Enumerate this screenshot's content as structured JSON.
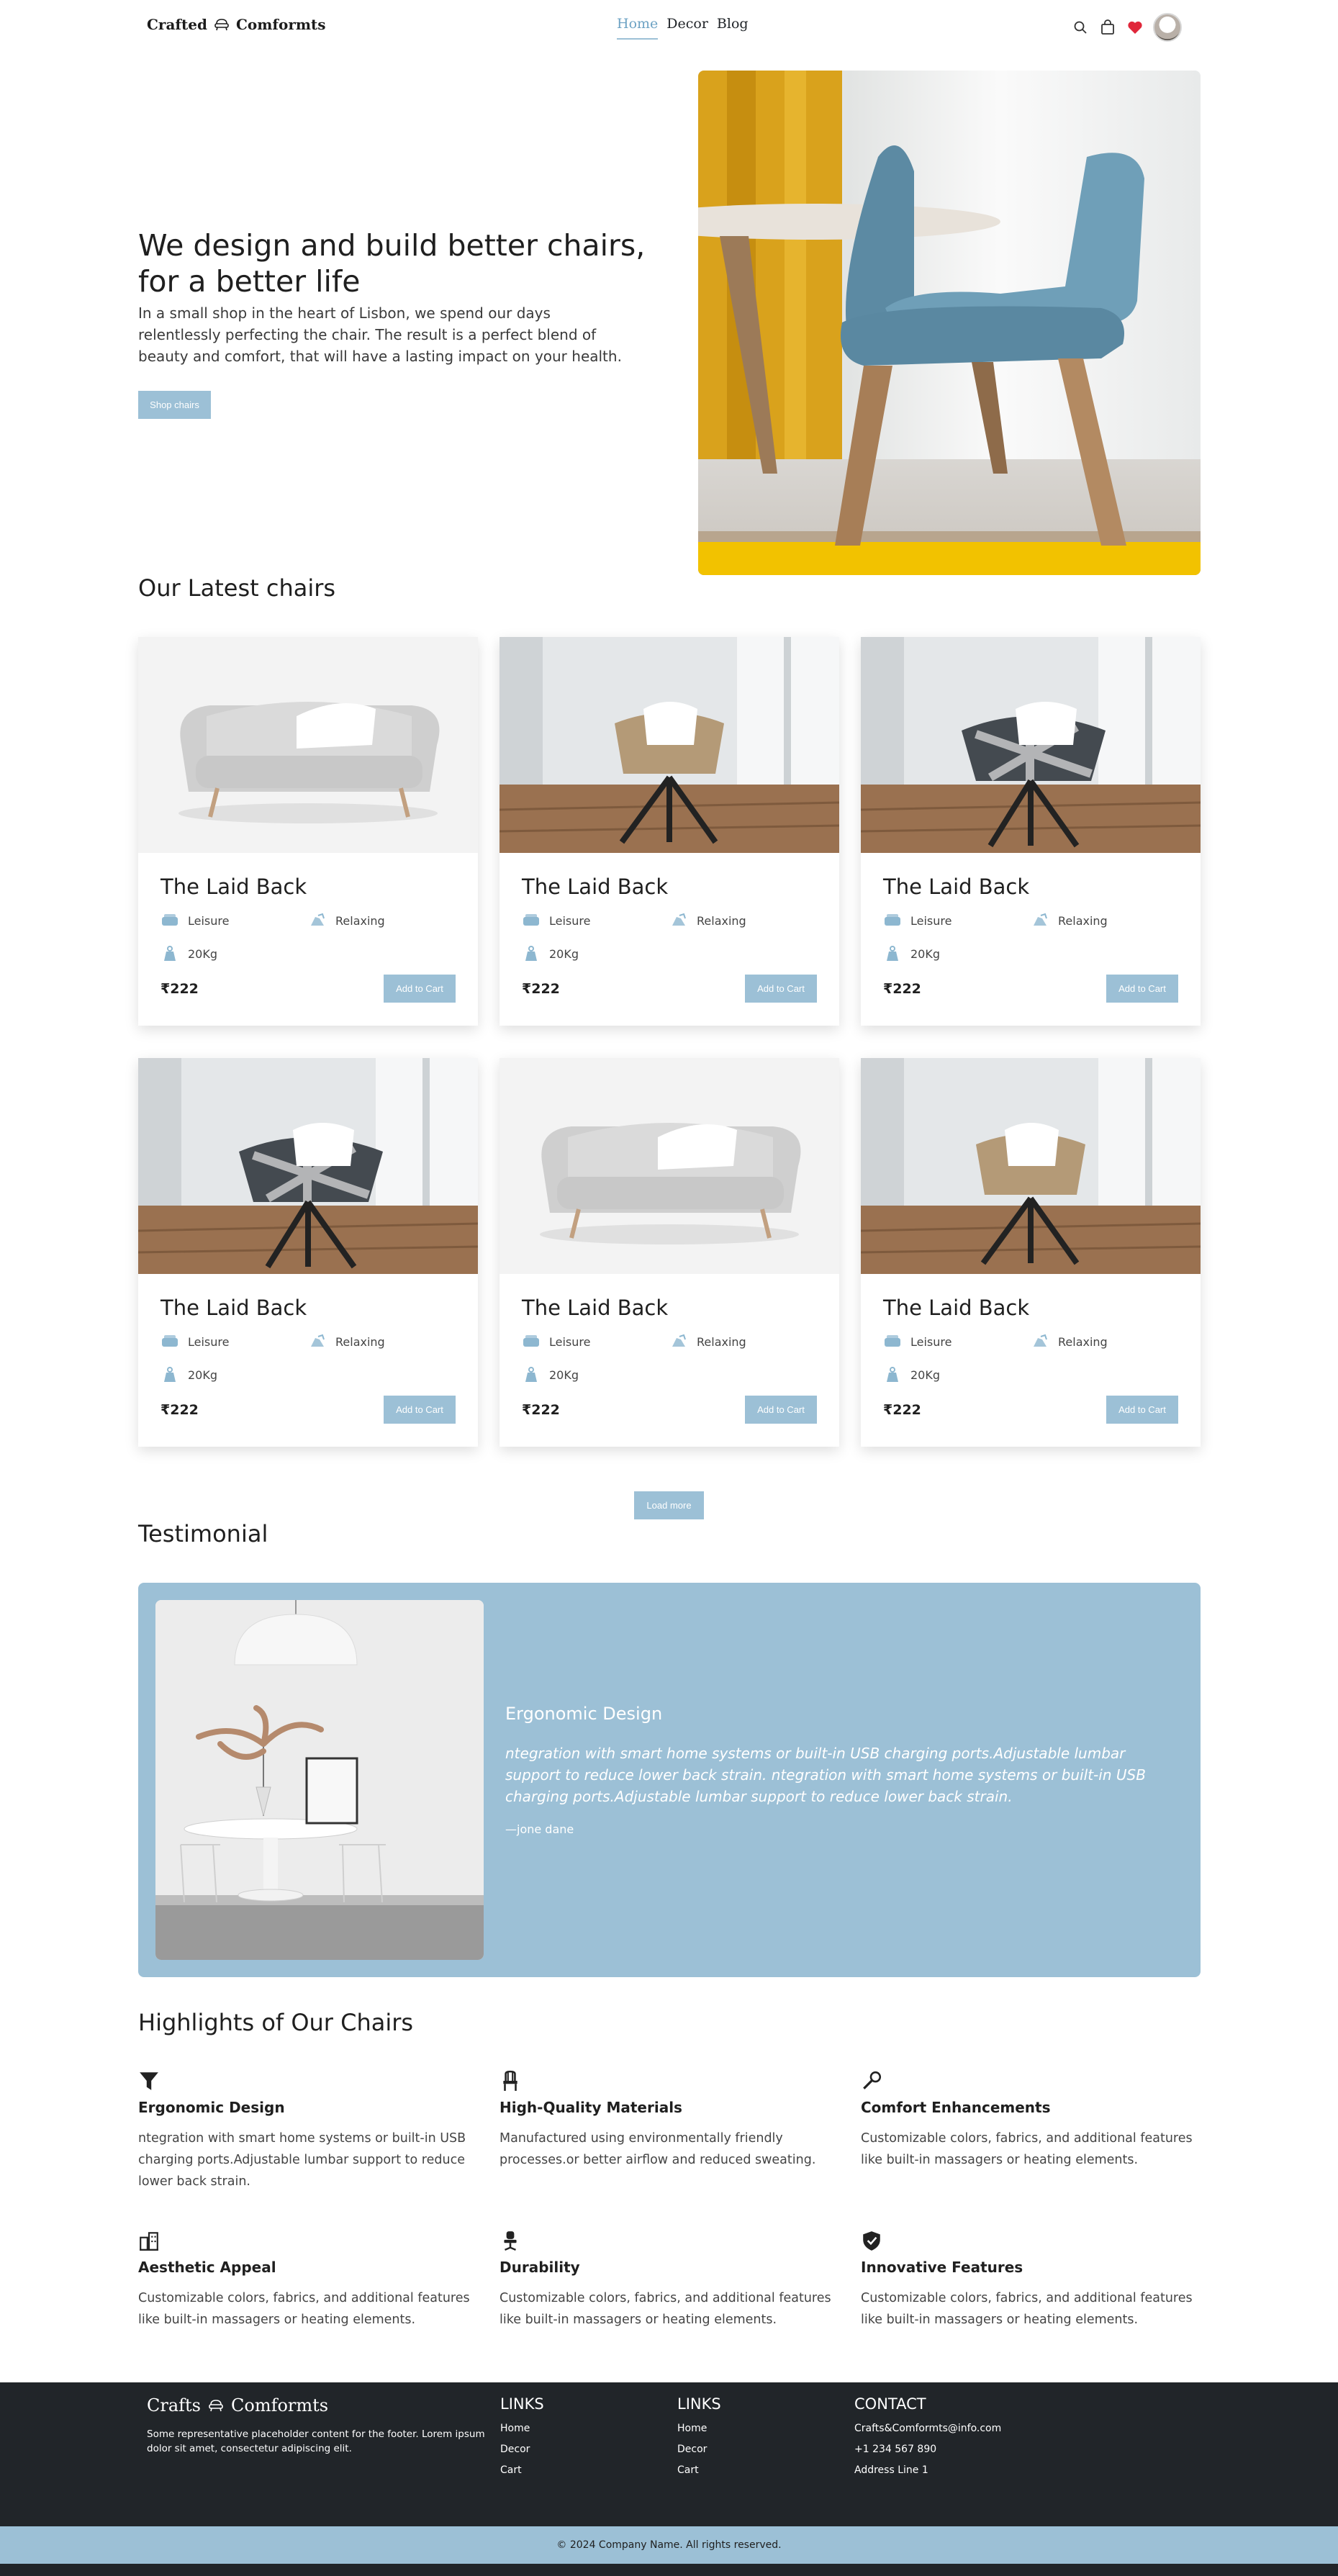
{
  "nav": {
    "brand_left": "Crafted",
    "brand_right": "Comformts",
    "links": [
      "Home",
      "Decor",
      "Blog"
    ],
    "active_link": "Home"
  },
  "hero": {
    "title": "We design and build better chairs, for a better life",
    "text": "In a small shop in the heart of Lisbon, we spend our days relentlessly perfecting the chair. The result is a perfect blend of beauty and comfort, that will have a lasting impact on your health.",
    "button": "Shop chairs"
  },
  "latest": {
    "title": "Our Latest chairs",
    "products": [
      {
        "name": "The Laid Back",
        "feature1": "Leisure",
        "feature2": "Relaxing",
        "weight": "20Kg",
        "price": "₹222",
        "button": "Add to Cart",
        "image": "sofa-icon"
      },
      {
        "name": "The Laid Back",
        "feature1": "Leisure",
        "feature2": "Relaxing",
        "weight": "20Kg",
        "price": "₹222",
        "button": "Add to Cart",
        "image": "tan-chair-icon"
      },
      {
        "name": "The Laid Back",
        "feature1": "Leisure",
        "feature2": "Relaxing",
        "weight": "20Kg",
        "price": "₹222",
        "button": "Add to Cart",
        "image": "plaid-chair-icon"
      },
      {
        "name": "The Laid Back",
        "feature1": "Leisure",
        "feature2": "Relaxing",
        "weight": "20Kg",
        "price": "₹222",
        "button": "Add to Cart",
        "image": "plaid-chair-icon"
      },
      {
        "name": "The Laid Back",
        "feature1": "Leisure",
        "feature2": "Relaxing",
        "weight": "20Kg",
        "price": "₹222",
        "button": "Add to Cart",
        "image": "sofa-icon"
      },
      {
        "name": "The Laid Back",
        "feature1": "Leisure",
        "feature2": "Relaxing",
        "weight": "20Kg",
        "price": "₹222",
        "button": "Add to Cart",
        "image": "tan-chair-icon"
      }
    ],
    "load_more": "Load more"
  },
  "testimonial": {
    "title": "Testimonial",
    "card_title": "Ergonomic Design",
    "quote": "ntegration with smart home systems or built-in USB charging ports.Adjustable lumbar support to reduce lower back strain. ntegration with smart home systems or built-in USB charging ports.Adjustable lumbar support to reduce lower back strain.",
    "author": "—jone dane"
  },
  "highlights": {
    "title": "Highlights of Our Chairs",
    "items": [
      {
        "icon": "funnel-icon",
        "title": "Ergonomic Design",
        "text": "ntegration with smart home systems or built-in USB charging ports.Adjustable lumbar support to reduce lower back strain."
      },
      {
        "icon": "chair-icon",
        "title": "High-Quality Materials",
        "text": "Manufactured using environmentally friendly processes.or better airflow and reduced sweating."
      },
      {
        "icon": "wrench-icon",
        "title": "Comfort Enhancements",
        "text": "Customizable colors, fabrics, and additional features like built-in massagers or heating elements."
      },
      {
        "icon": "building-icon",
        "title": "Aesthetic Appeal",
        "text": "Customizable colors, fabrics, and additional features like built-in massagers or heating elements."
      },
      {
        "icon": "office-chair-icon",
        "title": "Durability",
        "text": "Customizable colors, fabrics, and additional features like built-in massagers or heating elements."
      },
      {
        "icon": "shield-check-icon",
        "title": "Innovative Features",
        "text": "Customizable colors, fabrics, and additional features like built-in massagers or heating elements."
      }
    ]
  },
  "footer": {
    "brand_left": "Crafts",
    "brand_right": "Comformts",
    "description": "Some representative placeholder content for the footer. Lorem ipsum dolor sit amet, consectetur adipiscing elit.",
    "links1": {
      "title": "LINKS",
      "items": [
        "Home",
        "Decor",
        "Cart"
      ]
    },
    "links2": {
      "title": "LINKS",
      "items": [
        "Home",
        "Decor",
        "Cart"
      ]
    },
    "contact": {
      "title": "CONTACT",
      "items": [
        "Crafts&Comformts@info.com",
        "+1 234 567 890",
        "Address Line 1"
      ]
    },
    "copyright": "© 2024 Company Name. All rights reserved."
  },
  "colors": {
    "accent": "#9cc0d6",
    "active_link": "#6ea3c4",
    "heart": "#e0273a",
    "footer_bg": "#212529"
  }
}
